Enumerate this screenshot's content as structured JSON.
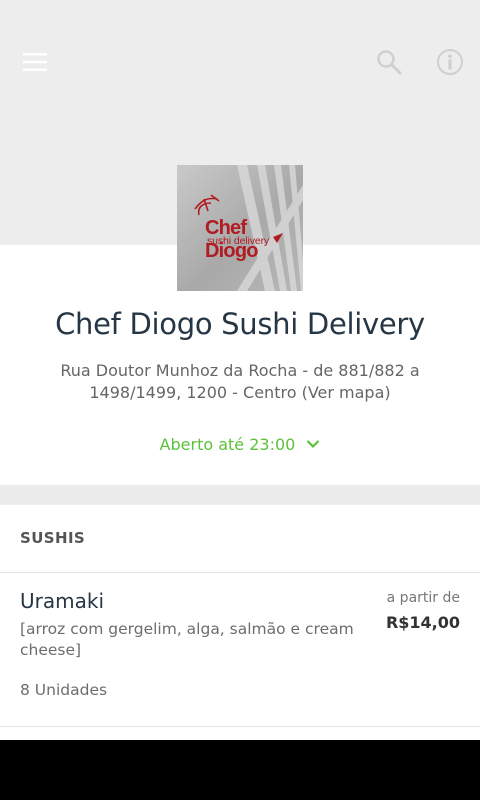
{
  "header": {
    "icons": [
      "menu-icon",
      "search-icon",
      "info-icon"
    ]
  },
  "restaurant": {
    "logo_text": "Chef Diogo",
    "logo_subtext": "sushi delivery",
    "name": "Chef Diogo Sushi Delivery",
    "address": "Rua Doutor Munhoz da Rocha - de 881/882 a 1498/1499, 1200 - Centro (Ver mapa)",
    "status": "Aberto até 23:00"
  },
  "section": {
    "title": "SUSHIS"
  },
  "items": [
    {
      "name": "Uramaki",
      "description": "[arroz com gergelim, alga, salmão e cream cheese]",
      "units": "8 Unidades",
      "price_label": "a partir de",
      "price": "R$14,00"
    }
  ],
  "colors": {
    "accent_green": "#5cc23a",
    "title_dark": "#263645",
    "logo_red": "#b11b22"
  }
}
